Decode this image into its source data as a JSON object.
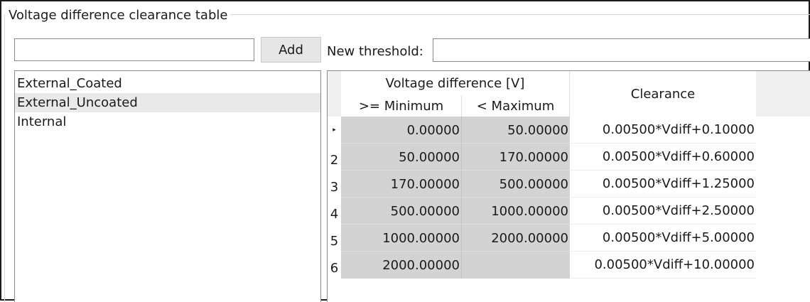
{
  "group": {
    "title": "Voltage difference clearance table"
  },
  "add_bar": {
    "input_value": "",
    "add_label": "Add"
  },
  "threshold": {
    "label": "New threshold:",
    "input_value": ""
  },
  "categories": [
    {
      "label": "External_Coated",
      "selected": false
    },
    {
      "label": "External_Uncoated",
      "selected": true
    },
    {
      "label": "Internal",
      "selected": false
    }
  ],
  "grid": {
    "header_group": "Voltage difference [V]",
    "header_min": ">= Minimum",
    "header_max": "< Maximum",
    "header_clearance": "Clearance",
    "current_row_marker": "▸",
    "rows": [
      {
        "index": "",
        "min": "0.00000",
        "max": "50.00000",
        "clearance": "0.00500*Vdiff+0.10000"
      },
      {
        "index": "2",
        "min": "50.00000",
        "max": "170.00000",
        "clearance": "0.00500*Vdiff+0.60000"
      },
      {
        "index": "3",
        "min": "170.00000",
        "max": "500.00000",
        "clearance": "0.00500*Vdiff+1.25000"
      },
      {
        "index": "4",
        "min": "500.00000",
        "max": "1000.00000",
        "clearance": "0.00500*Vdiff+2.50000"
      },
      {
        "index": "5",
        "min": "1000.00000",
        "max": "2000.00000",
        "clearance": "0.00500*Vdiff+5.00000"
      },
      {
        "index": "6",
        "min": "2000.00000",
        "max": "",
        "clearance": "0.00500*Vdiff+10.00000"
      }
    ]
  }
}
